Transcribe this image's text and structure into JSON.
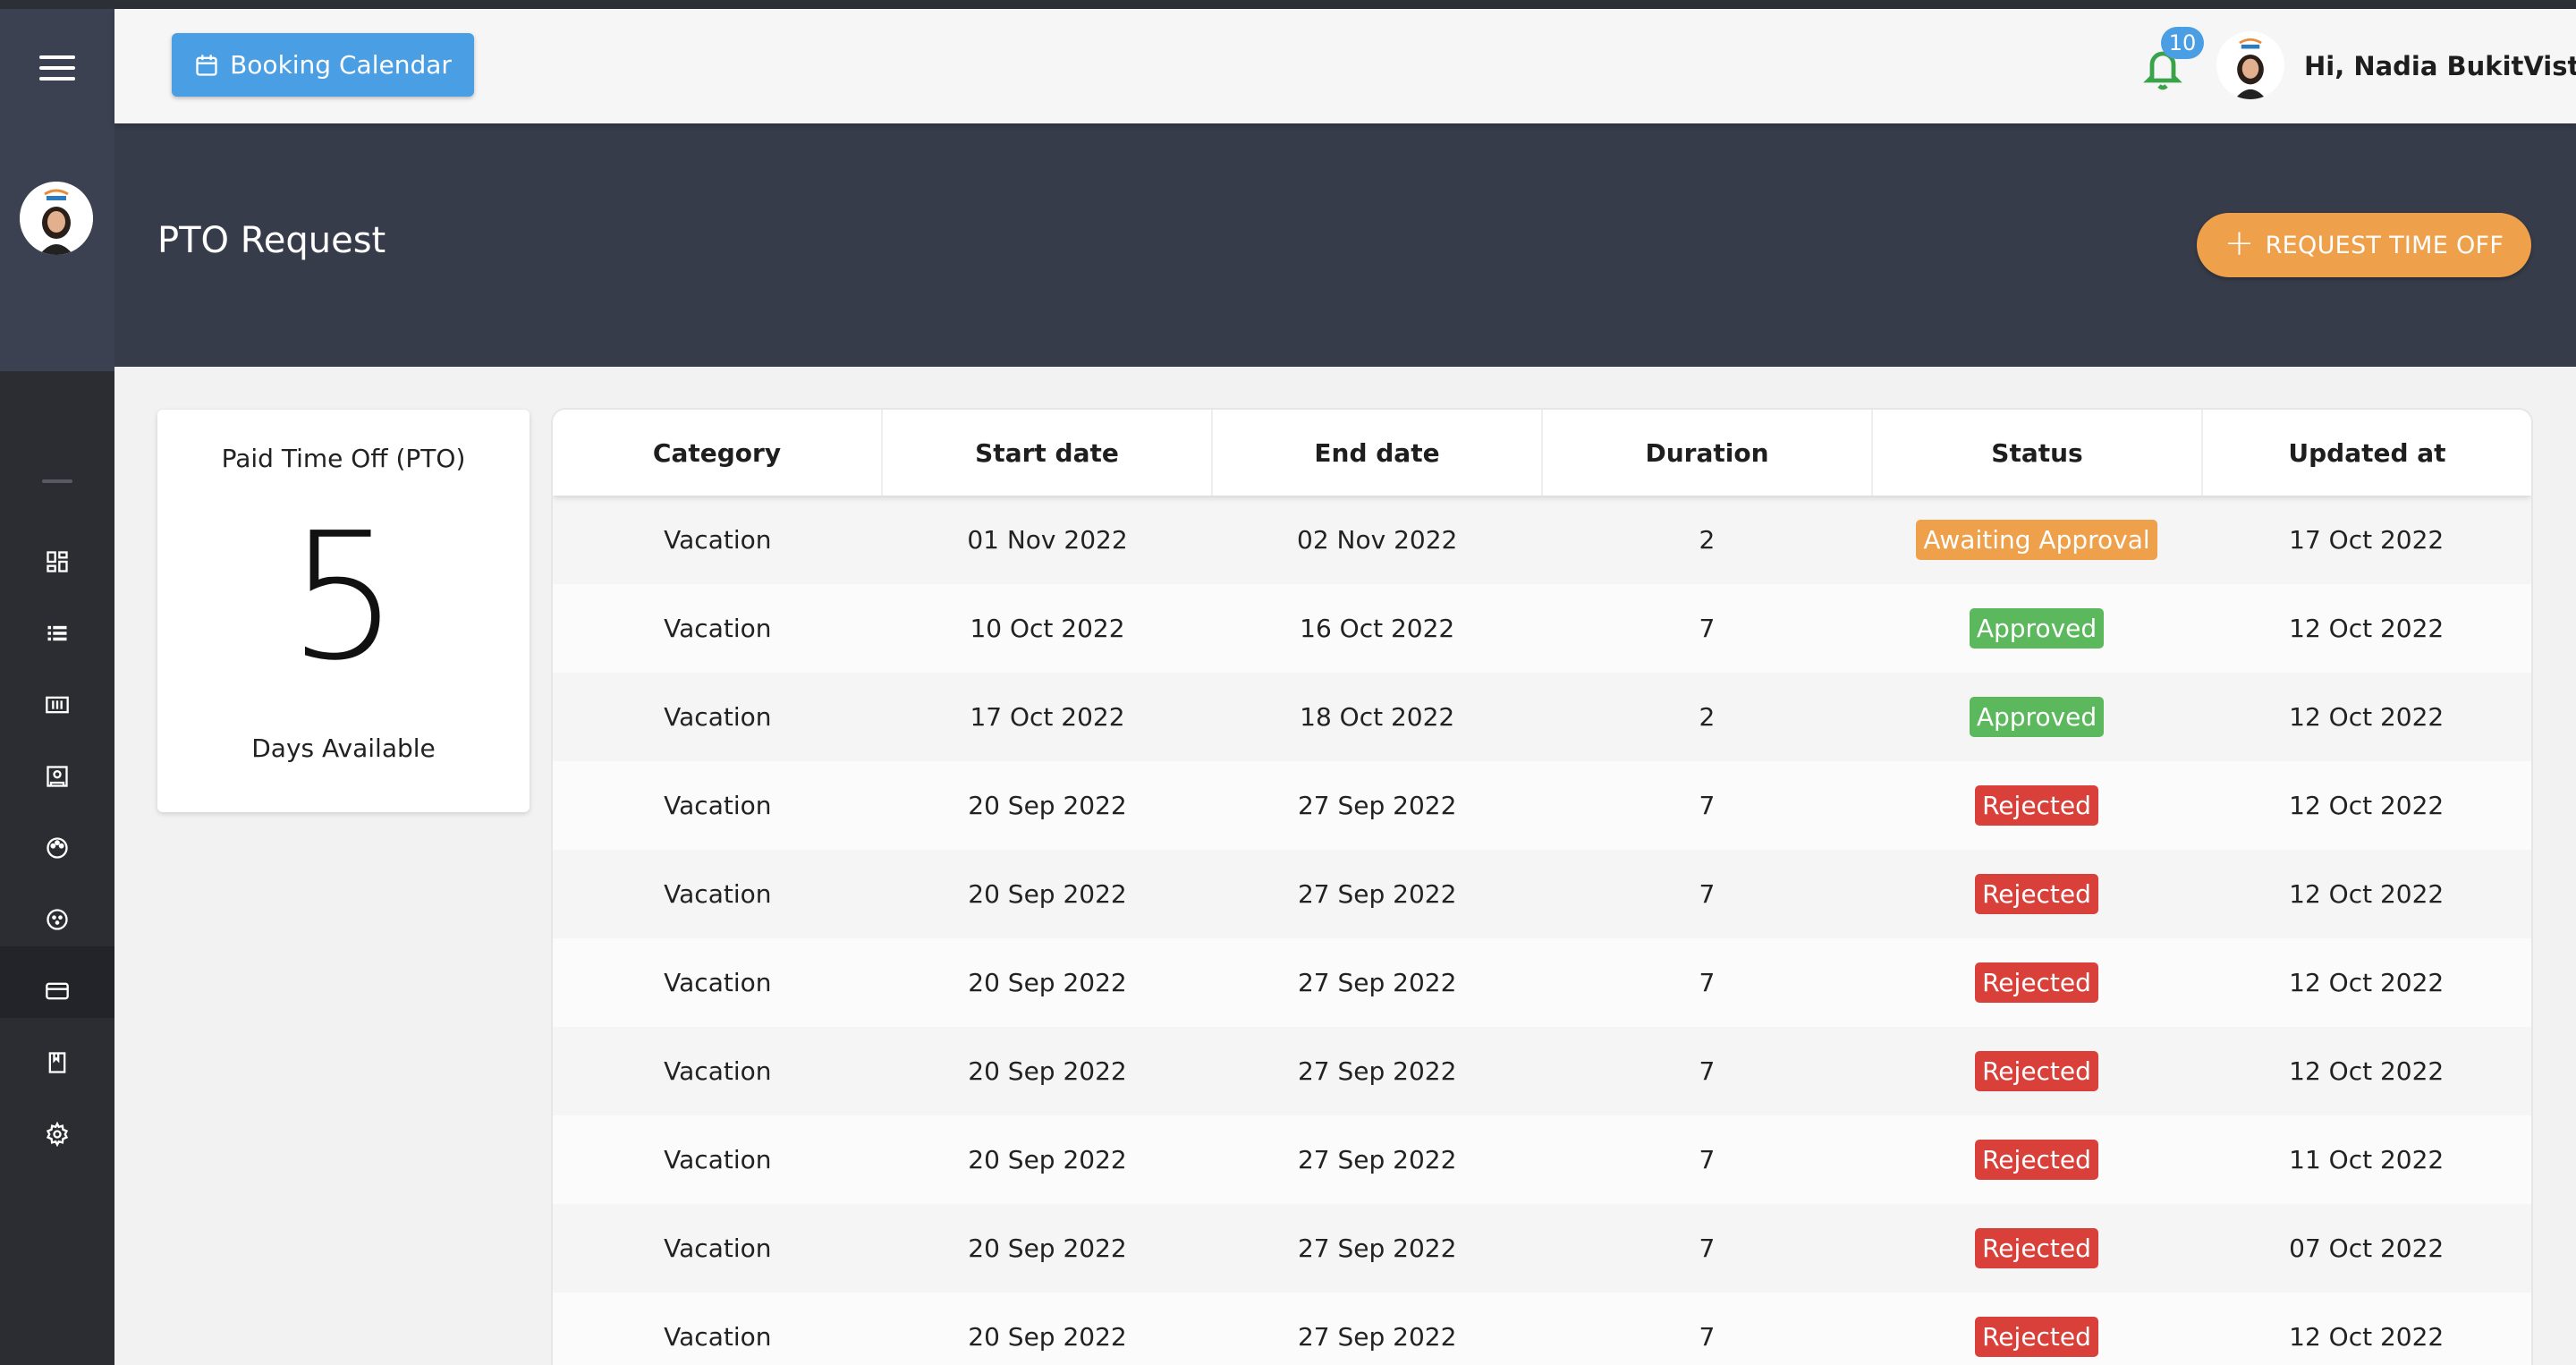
{
  "header": {
    "booking_label": "Booking Calendar",
    "notification_count": "10",
    "greeting": "Hi, Nadia BukitVista"
  },
  "banner": {
    "title": "PTO Request",
    "request_label": "REQUEST TIME OFF"
  },
  "pto": {
    "title": "Paid Time Off (PTO)",
    "days": "5",
    "subtitle": "Days Available"
  },
  "sidebar": {
    "icons": [
      "dashboard-icon",
      "list-icon",
      "calendar-grid-icon",
      "report-icon",
      "palette-icon",
      "face-icon",
      "card-icon",
      "book-icon",
      "gear-icon"
    ]
  },
  "table": {
    "columns": [
      "Category",
      "Start date",
      "End date",
      "Duration",
      "Status",
      "Updated at"
    ],
    "rows": [
      {
        "category": "Vacation",
        "start": "01 Nov 2022",
        "end": "02 Nov 2022",
        "duration": "2",
        "status": "Awaiting Approval",
        "status_type": "awaiting",
        "updated": "17 Oct 2022"
      },
      {
        "category": "Vacation",
        "start": "10 Oct 2022",
        "end": "16 Oct 2022",
        "duration": "7",
        "status": "Approved",
        "status_type": "approved",
        "updated": "12 Oct 2022"
      },
      {
        "category": "Vacation",
        "start": "17 Oct 2022",
        "end": "18 Oct 2022",
        "duration": "2",
        "status": "Approved",
        "status_type": "approved",
        "updated": "12 Oct 2022"
      },
      {
        "category": "Vacation",
        "start": "20 Sep 2022",
        "end": "27 Sep 2022",
        "duration": "7",
        "status": "Rejected",
        "status_type": "rejected",
        "updated": "12 Oct 2022"
      },
      {
        "category": "Vacation",
        "start": "20 Sep 2022",
        "end": "27 Sep 2022",
        "duration": "7",
        "status": "Rejected",
        "status_type": "rejected",
        "updated": "12 Oct 2022"
      },
      {
        "category": "Vacation",
        "start": "20 Sep 2022",
        "end": "27 Sep 2022",
        "duration": "7",
        "status": "Rejected",
        "status_type": "rejected",
        "updated": "12 Oct 2022"
      },
      {
        "category": "Vacation",
        "start": "20 Sep 2022",
        "end": "27 Sep 2022",
        "duration": "7",
        "status": "Rejected",
        "status_type": "rejected",
        "updated": "12 Oct 2022"
      },
      {
        "category": "Vacation",
        "start": "20 Sep 2022",
        "end": "27 Sep 2022",
        "duration": "7",
        "status": "Rejected",
        "status_type": "rejected",
        "updated": "11 Oct 2022"
      },
      {
        "category": "Vacation",
        "start": "20 Sep 2022",
        "end": "27 Sep 2022",
        "duration": "7",
        "status": "Rejected",
        "status_type": "rejected",
        "updated": "07 Oct 2022"
      },
      {
        "category": "Vacation",
        "start": "20 Sep 2022",
        "end": "27 Sep 2022",
        "duration": "7",
        "status": "Rejected",
        "status_type": "rejected",
        "updated": "12 Oct 2022"
      }
    ]
  },
  "colors": {
    "primary_blue": "#4a9ee3",
    "accent_orange": "#eea04b",
    "approved_green": "#5cb85c",
    "rejected_red": "#d9403a",
    "banner_dark": "#373c4a",
    "sidebar_dark": "#2b2d33"
  }
}
